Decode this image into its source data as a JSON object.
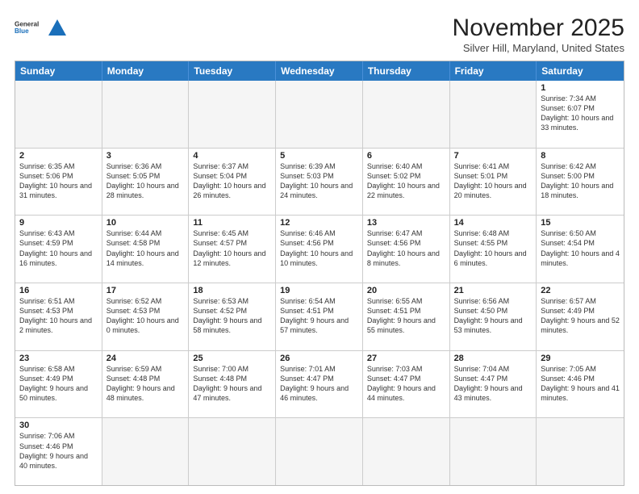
{
  "header": {
    "logo_general": "General",
    "logo_blue": "Blue",
    "month_title": "November 2025",
    "location": "Silver Hill, Maryland, United States"
  },
  "days_of_week": [
    "Sunday",
    "Monday",
    "Tuesday",
    "Wednesday",
    "Thursday",
    "Friday",
    "Saturday"
  ],
  "weeks": [
    [
      {
        "day": "",
        "info": ""
      },
      {
        "day": "",
        "info": ""
      },
      {
        "day": "",
        "info": ""
      },
      {
        "day": "",
        "info": ""
      },
      {
        "day": "",
        "info": ""
      },
      {
        "day": "",
        "info": ""
      },
      {
        "day": "1",
        "info": "Sunrise: 7:34 AM\nSunset: 6:07 PM\nDaylight: 10 hours and 33 minutes."
      }
    ],
    [
      {
        "day": "2",
        "info": "Sunrise: 6:35 AM\nSunset: 5:06 PM\nDaylight: 10 hours and 31 minutes."
      },
      {
        "day": "3",
        "info": "Sunrise: 6:36 AM\nSunset: 5:05 PM\nDaylight: 10 hours and 28 minutes."
      },
      {
        "day": "4",
        "info": "Sunrise: 6:37 AM\nSunset: 5:04 PM\nDaylight: 10 hours and 26 minutes."
      },
      {
        "day": "5",
        "info": "Sunrise: 6:39 AM\nSunset: 5:03 PM\nDaylight: 10 hours and 24 minutes."
      },
      {
        "day": "6",
        "info": "Sunrise: 6:40 AM\nSunset: 5:02 PM\nDaylight: 10 hours and 22 minutes."
      },
      {
        "day": "7",
        "info": "Sunrise: 6:41 AM\nSunset: 5:01 PM\nDaylight: 10 hours and 20 minutes."
      },
      {
        "day": "8",
        "info": "Sunrise: 6:42 AM\nSunset: 5:00 PM\nDaylight: 10 hours and 18 minutes."
      }
    ],
    [
      {
        "day": "9",
        "info": "Sunrise: 6:43 AM\nSunset: 4:59 PM\nDaylight: 10 hours and 16 minutes."
      },
      {
        "day": "10",
        "info": "Sunrise: 6:44 AM\nSunset: 4:58 PM\nDaylight: 10 hours and 14 minutes."
      },
      {
        "day": "11",
        "info": "Sunrise: 6:45 AM\nSunset: 4:57 PM\nDaylight: 10 hours and 12 minutes."
      },
      {
        "day": "12",
        "info": "Sunrise: 6:46 AM\nSunset: 4:56 PM\nDaylight: 10 hours and 10 minutes."
      },
      {
        "day": "13",
        "info": "Sunrise: 6:47 AM\nSunset: 4:56 PM\nDaylight: 10 hours and 8 minutes."
      },
      {
        "day": "14",
        "info": "Sunrise: 6:48 AM\nSunset: 4:55 PM\nDaylight: 10 hours and 6 minutes."
      },
      {
        "day": "15",
        "info": "Sunrise: 6:50 AM\nSunset: 4:54 PM\nDaylight: 10 hours and 4 minutes."
      }
    ],
    [
      {
        "day": "16",
        "info": "Sunrise: 6:51 AM\nSunset: 4:53 PM\nDaylight: 10 hours and 2 minutes."
      },
      {
        "day": "17",
        "info": "Sunrise: 6:52 AM\nSunset: 4:53 PM\nDaylight: 10 hours and 0 minutes."
      },
      {
        "day": "18",
        "info": "Sunrise: 6:53 AM\nSunset: 4:52 PM\nDaylight: 9 hours and 58 minutes."
      },
      {
        "day": "19",
        "info": "Sunrise: 6:54 AM\nSunset: 4:51 PM\nDaylight: 9 hours and 57 minutes."
      },
      {
        "day": "20",
        "info": "Sunrise: 6:55 AM\nSunset: 4:51 PM\nDaylight: 9 hours and 55 minutes."
      },
      {
        "day": "21",
        "info": "Sunrise: 6:56 AM\nSunset: 4:50 PM\nDaylight: 9 hours and 53 minutes."
      },
      {
        "day": "22",
        "info": "Sunrise: 6:57 AM\nSunset: 4:49 PM\nDaylight: 9 hours and 52 minutes."
      }
    ],
    [
      {
        "day": "23",
        "info": "Sunrise: 6:58 AM\nSunset: 4:49 PM\nDaylight: 9 hours and 50 minutes."
      },
      {
        "day": "24",
        "info": "Sunrise: 6:59 AM\nSunset: 4:48 PM\nDaylight: 9 hours and 48 minutes."
      },
      {
        "day": "25",
        "info": "Sunrise: 7:00 AM\nSunset: 4:48 PM\nDaylight: 9 hours and 47 minutes."
      },
      {
        "day": "26",
        "info": "Sunrise: 7:01 AM\nSunset: 4:47 PM\nDaylight: 9 hours and 46 minutes."
      },
      {
        "day": "27",
        "info": "Sunrise: 7:03 AM\nSunset: 4:47 PM\nDaylight: 9 hours and 44 minutes."
      },
      {
        "day": "28",
        "info": "Sunrise: 7:04 AM\nSunset: 4:47 PM\nDaylight: 9 hours and 43 minutes."
      },
      {
        "day": "29",
        "info": "Sunrise: 7:05 AM\nSunset: 4:46 PM\nDaylight: 9 hours and 41 minutes."
      }
    ],
    [
      {
        "day": "30",
        "info": "Sunrise: 7:06 AM\nSunset: 4:46 PM\nDaylight: 9 hours and 40 minutes."
      },
      {
        "day": "",
        "info": ""
      },
      {
        "day": "",
        "info": ""
      },
      {
        "day": "",
        "info": ""
      },
      {
        "day": "",
        "info": ""
      },
      {
        "day": "",
        "info": ""
      },
      {
        "day": "",
        "info": ""
      }
    ]
  ]
}
